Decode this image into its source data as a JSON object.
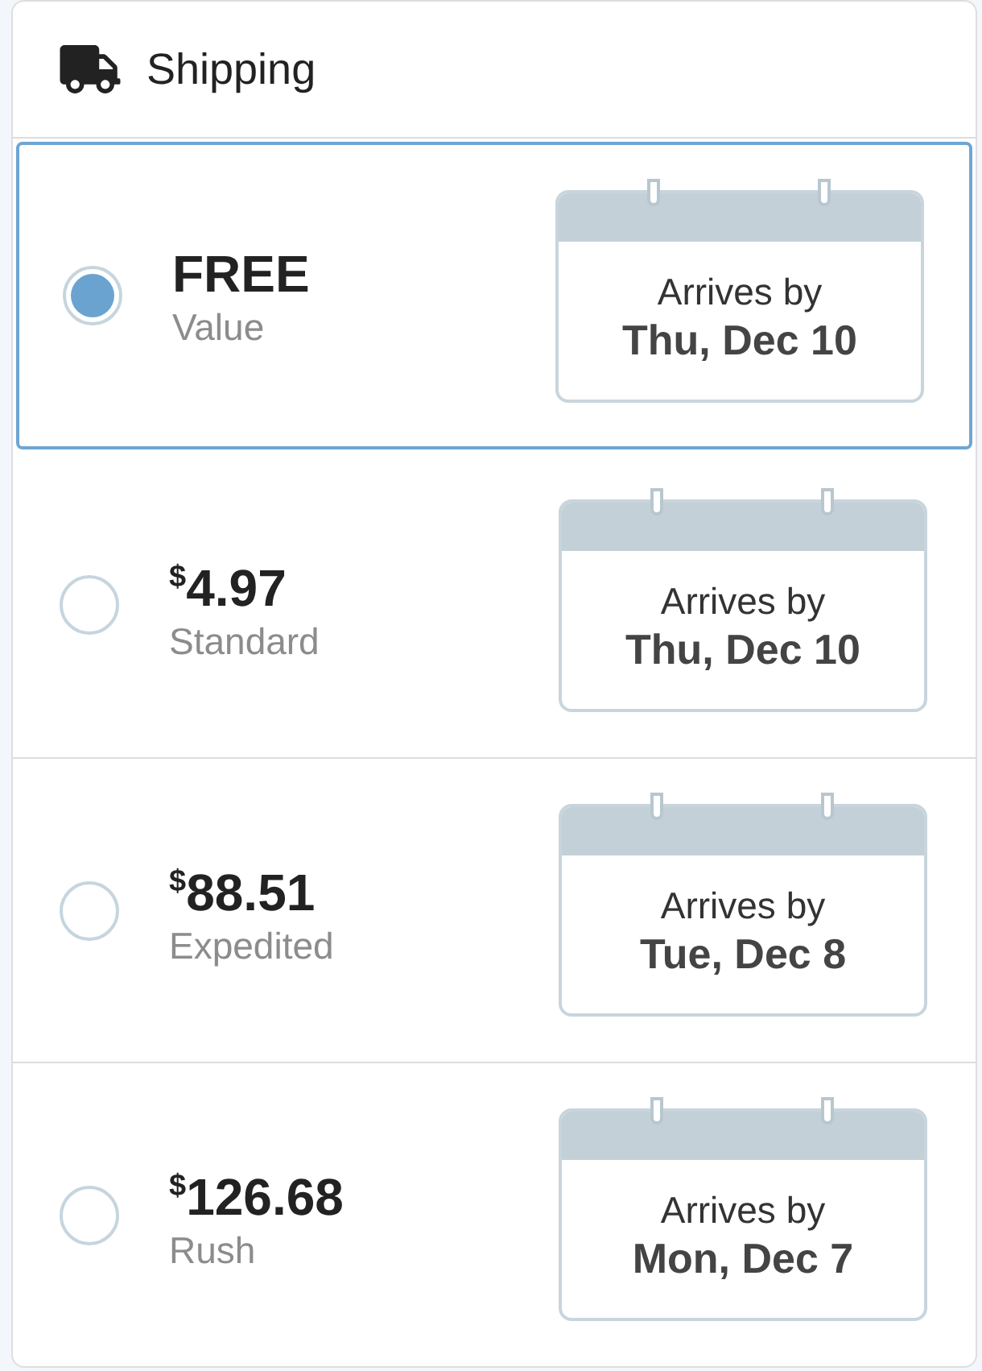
{
  "header": {
    "title": "Shipping"
  },
  "options": [
    {
      "selected": true,
      "price": {
        "amount": "FREE"
      },
      "name": "Value",
      "arrival_label": "Arrives by",
      "arrival_date": "Thu, Dec 10"
    },
    {
      "selected": false,
      "price": {
        "currency": "$",
        "amount": "4.97"
      },
      "name": "Standard",
      "arrival_label": "Arrives by",
      "arrival_date": "Thu, Dec 10"
    },
    {
      "selected": false,
      "price": {
        "currency": "$",
        "amount": "88.51"
      },
      "name": "Expedited",
      "arrival_label": "Arrives by",
      "arrival_date": "Tue, Dec 8"
    },
    {
      "selected": false,
      "price": {
        "currency": "$",
        "amount": "126.68"
      },
      "name": "Rush",
      "arrival_label": "Arrives by",
      "arrival_date": "Mon, Dec 7"
    }
  ]
}
